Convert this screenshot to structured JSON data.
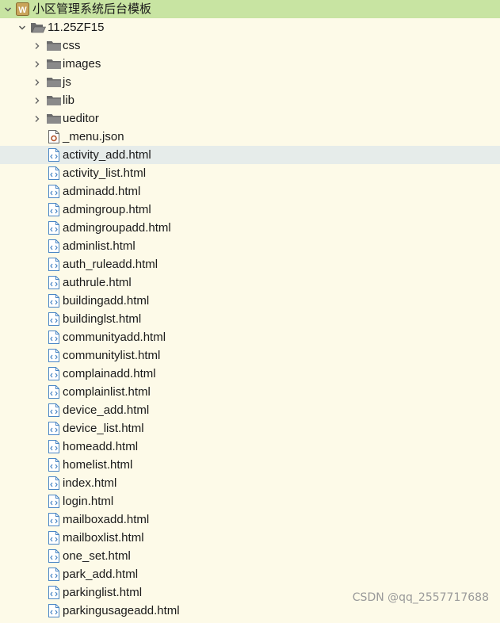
{
  "tree": {
    "project": {
      "label": "小区管理系统后台模板",
      "icon": "web-project-icon",
      "expanded": true
    },
    "root_folder": {
      "label": "11.25ZF15",
      "icon": "folder-open-icon",
      "expanded": true
    },
    "folders": [
      {
        "label": "css",
        "icon": "folder-icon"
      },
      {
        "label": "images",
        "icon": "folder-icon"
      },
      {
        "label": "js",
        "icon": "folder-icon"
      },
      {
        "label": "lib",
        "icon": "folder-icon"
      },
      {
        "label": "ueditor",
        "icon": "folder-icon"
      }
    ],
    "files": [
      {
        "label": "_menu.json",
        "icon": "json-file-icon"
      },
      {
        "label": "activity_add.html",
        "icon": "html-file-icon",
        "selected": true
      },
      {
        "label": "activity_list.html",
        "icon": "html-file-icon"
      },
      {
        "label": "adminadd.html",
        "icon": "html-file-icon"
      },
      {
        "label": "admingroup.html",
        "icon": "html-file-icon"
      },
      {
        "label": "admingroupadd.html",
        "icon": "html-file-icon"
      },
      {
        "label": "adminlist.html",
        "icon": "html-file-icon"
      },
      {
        "label": "auth_ruleadd.html",
        "icon": "html-file-icon"
      },
      {
        "label": "authrule.html",
        "icon": "html-file-icon"
      },
      {
        "label": "buildingadd.html",
        "icon": "html-file-icon"
      },
      {
        "label": "buildinglst.html",
        "icon": "html-file-icon"
      },
      {
        "label": "communityadd.html",
        "icon": "html-file-icon"
      },
      {
        "label": "communitylist.html",
        "icon": "html-file-icon"
      },
      {
        "label": "complainadd.html",
        "icon": "html-file-icon"
      },
      {
        "label": "complainlist.html",
        "icon": "html-file-icon"
      },
      {
        "label": "device_add.html",
        "icon": "html-file-icon"
      },
      {
        "label": "device_list.html",
        "icon": "html-file-icon"
      },
      {
        "label": "homeadd.html",
        "icon": "html-file-icon"
      },
      {
        "label": "homelist.html",
        "icon": "html-file-icon"
      },
      {
        "label": "index.html",
        "icon": "html-file-icon"
      },
      {
        "label": "login.html",
        "icon": "html-file-icon"
      },
      {
        "label": "mailboxadd.html",
        "icon": "html-file-icon"
      },
      {
        "label": "mailboxlist.html",
        "icon": "html-file-icon"
      },
      {
        "label": "one_set.html",
        "icon": "html-file-icon"
      },
      {
        "label": "park_add.html",
        "icon": "html-file-icon"
      },
      {
        "label": "parkinglist.html",
        "icon": "html-file-icon"
      },
      {
        "label": "parkingusageadd.html",
        "icon": "html-file-icon"
      }
    ]
  },
  "colors": {
    "background": "#fdfae8",
    "project_highlight": "#c8e4a2",
    "selected_row": "#e6ecea",
    "html_icon": "#4a86c5",
    "json_icon": "#b2532a",
    "folder": "#555555"
  },
  "watermark": "CSDN @qq_2557717688"
}
